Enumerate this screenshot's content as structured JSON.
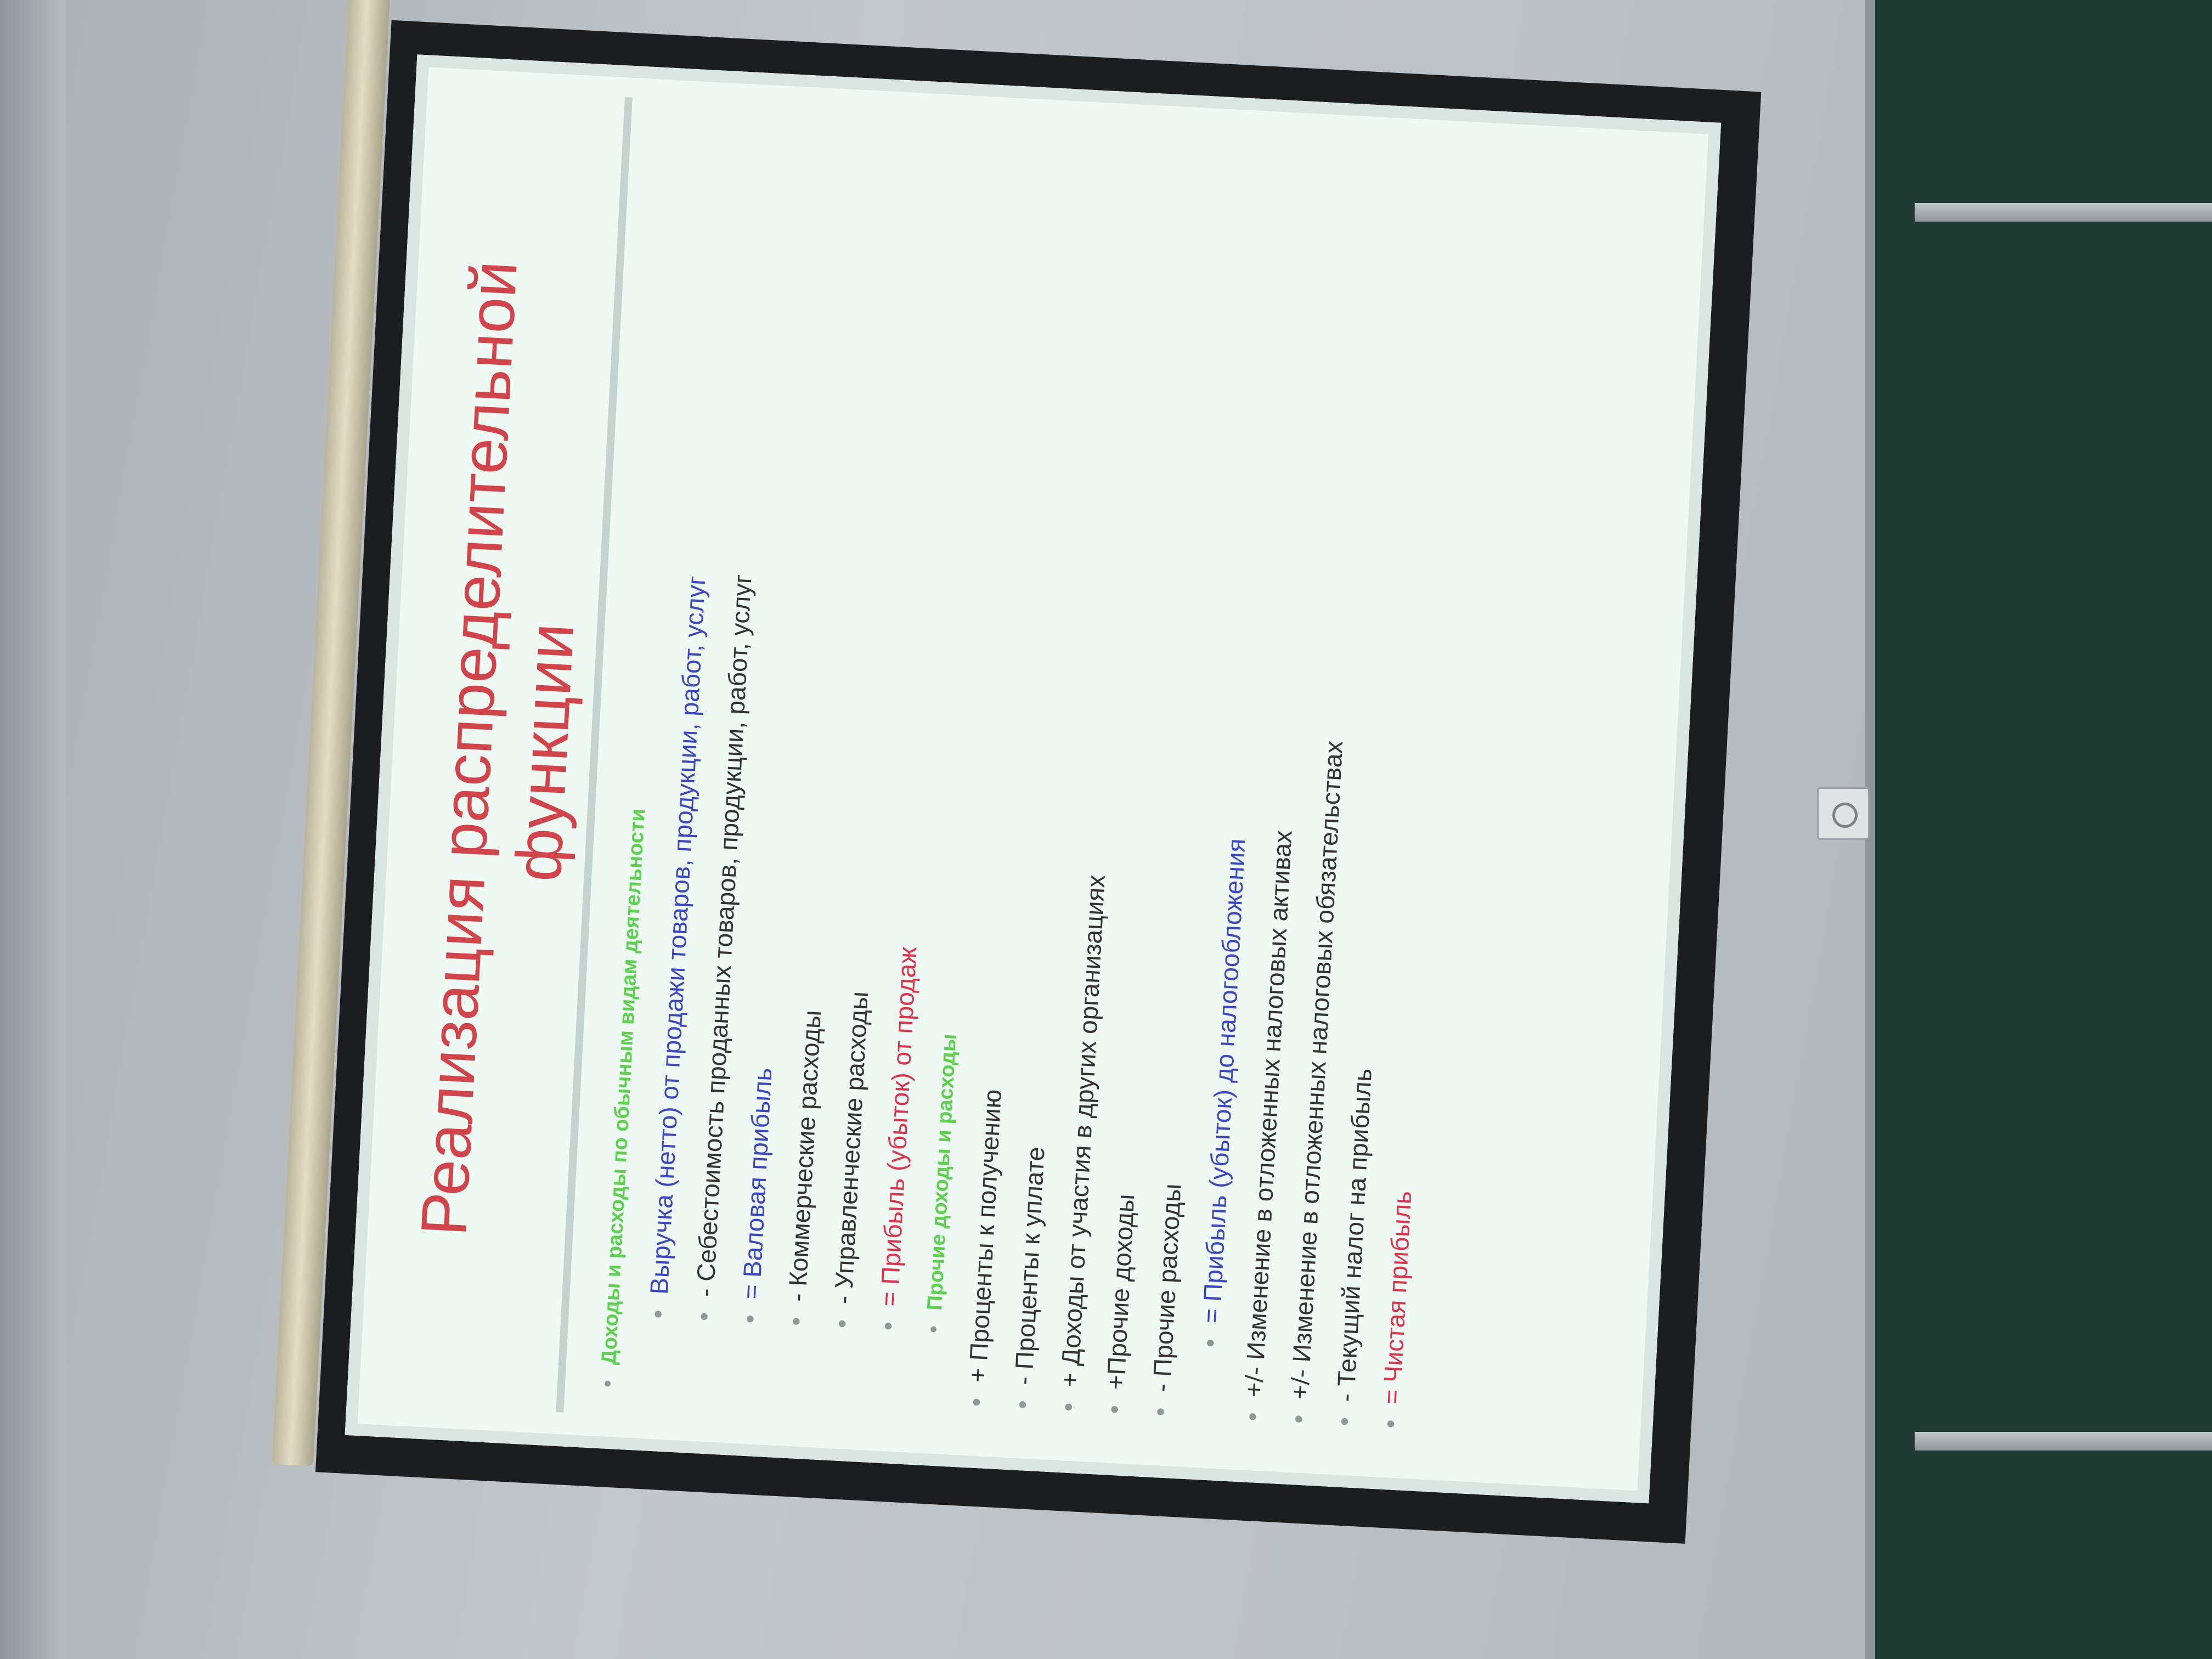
{
  "slide": {
    "title_line1": "Реализация распределительной",
    "title_line2": "функции",
    "items": [
      {
        "text": "Доходы и расходы по обычным видам деятельности",
        "color": "#5bd14c"
      },
      {
        "text": "Выручка (нетто) от продажи товаров, продукции, работ, услуг",
        "color": "#3a45c8"
      },
      {
        "text": "- Себестоимость проданных товаров, продукции, работ, услуг",
        "color": "#333333"
      },
      {
        "text": "= Валовая прибыль",
        "color": "#3a45c8"
      },
      {
        "text": "- Коммерческие расходы",
        "color": "#333333"
      },
      {
        "text": "- Управленческие расходы",
        "color": "#333333"
      },
      {
        "text": "= Прибыль (убыток) от продаж",
        "color": "#e0304a"
      },
      {
        "text": "Прочие доходы и расходы",
        "color": "#5bd14c"
      },
      {
        "text": "+ Проценты к получению",
        "color": "#333333"
      },
      {
        "text": "- Проценты к уплате",
        "color": "#333333"
      },
      {
        "text": "+ Доходы от участия в других организациях",
        "color": "#333333"
      },
      {
        "text": "+Прочие доходы",
        "color": "#333333"
      },
      {
        "text": "- Прочие  расходы",
        "color": "#333333"
      },
      {
        "text": "= Прибыль (убыток) до налогообложения",
        "color": "#3a45c8"
      },
      {
        "text": "+/- Изменение в отложенных налоговых активах",
        "color": "#333333"
      },
      {
        "text": "+/- Изменение в отложенных налоговых обязательствах",
        "color": "#333333"
      },
      {
        "text": "- Текущий налог на прибыль",
        "color": "#333333"
      },
      {
        "text": "= Чистая прибыль",
        "color": "#e0304a"
      }
    ]
  }
}
